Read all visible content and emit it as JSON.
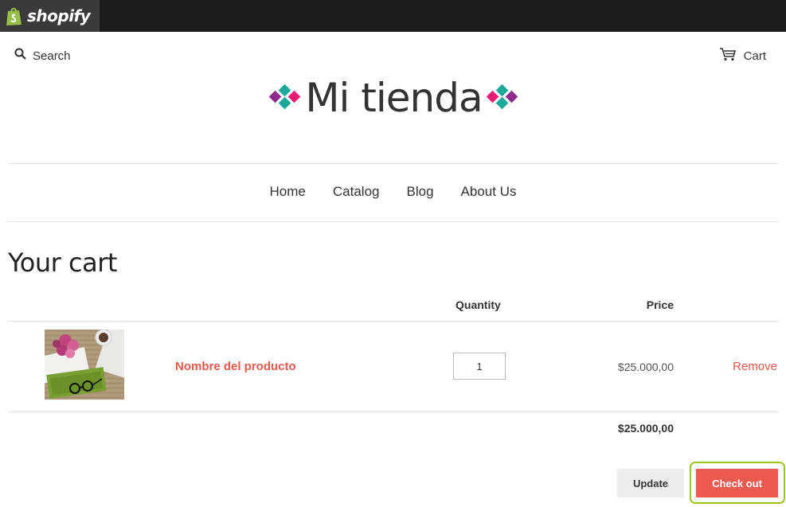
{
  "admin_bar": {
    "brand": "shopify"
  },
  "header": {
    "search_label": "Search",
    "cart_label": "Cart",
    "store_name": "Mi tienda"
  },
  "nav": {
    "items": [
      {
        "label": "Home"
      },
      {
        "label": "Catalog"
      },
      {
        "label": "Blog"
      },
      {
        "label": "About Us"
      }
    ]
  },
  "cart": {
    "title": "Your cart",
    "columns": {
      "quantity": "Quantity",
      "price": "Price"
    },
    "items": [
      {
        "name": "Nombre del producto",
        "quantity": "1",
        "price": "$25.000,00",
        "remove_label": "Remove"
      }
    ],
    "total": "$25.000,00",
    "update_label": "Update",
    "checkout_label": "Check out"
  },
  "colors": {
    "accent": "#ef5a50",
    "link": "#e45a4e",
    "highlight_ring": "#9cc41d",
    "admin_bar": "#1c1c1c"
  },
  "icons": [
    "shopify-bag-icon",
    "search-icon",
    "cart-icon",
    "logo-diamond-icon"
  ]
}
